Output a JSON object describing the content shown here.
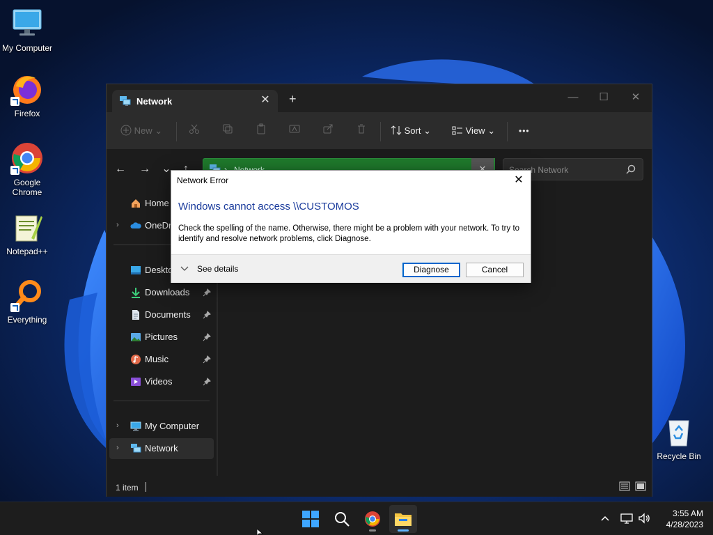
{
  "desktop": {
    "icons": [
      {
        "label": "My Computer",
        "icon": "monitor-icon"
      },
      {
        "label": "Firefox",
        "icon": "firefox-icon"
      },
      {
        "label": "Google Chrome",
        "icon": "chrome-icon"
      },
      {
        "label": "Notepad++",
        "icon": "notepad-plus-plus-icon"
      },
      {
        "label": "Everything",
        "icon": "everything-search-icon"
      },
      {
        "label": "Recycle Bin",
        "icon": "recycle-bin-icon"
      }
    ]
  },
  "explorer": {
    "tab_title": "Network",
    "tab_close": "✕",
    "new_tab": "+",
    "window_controls": {
      "minimize": "—",
      "maximize": "☐",
      "close": "✕"
    },
    "toolbar": {
      "new_label": "New",
      "sort_label": "Sort",
      "view_label": "View",
      "more_label": "•••"
    },
    "address": {
      "path": "Network",
      "clear": "✕"
    },
    "search": {
      "placeholder": "Search Network"
    },
    "sidebar": {
      "items": [
        {
          "label": "Home",
          "icon": "home-icon",
          "pinned": false,
          "expandable": false
        },
        {
          "label": "OneDrive",
          "icon": "cloud-icon",
          "pinned": false,
          "expandable": true
        },
        {
          "label": "Desktop",
          "icon": "desktop-folder-icon",
          "pinned": true,
          "expandable": false
        },
        {
          "label": "Downloads",
          "icon": "download-icon",
          "pinned": true,
          "expandable": false
        },
        {
          "label": "Documents",
          "icon": "documents-icon",
          "pinned": true,
          "expandable": false
        },
        {
          "label": "Pictures",
          "icon": "pictures-icon",
          "pinned": true,
          "expandable": false
        },
        {
          "label": "Music",
          "icon": "music-icon",
          "pinned": true,
          "expandable": false
        },
        {
          "label": "Videos",
          "icon": "videos-icon",
          "pinned": true,
          "expandable": false
        },
        {
          "label": "My Computer",
          "icon": "monitor-icon",
          "pinned": false,
          "expandable": true
        },
        {
          "label": "Network",
          "icon": "network-icon",
          "pinned": false,
          "expandable": true,
          "selected": true
        }
      ]
    },
    "status": {
      "item_count": "1 item"
    }
  },
  "dialog": {
    "title": "Network Error",
    "close": "✕",
    "heading": "Windows cannot access \\\\CUSTOMOS",
    "message": "Check the spelling of the name. Otherwise, there might be a problem with your network. To try to identify and resolve network problems, click Diagnose.",
    "details_label": "See details",
    "diagnose_label": "Diagnose",
    "cancel_label": "Cancel"
  },
  "taskbar": {
    "apps": [
      {
        "name": "start-button",
        "icon": "windows-logo-icon"
      },
      {
        "name": "search-button",
        "icon": "search-icon"
      },
      {
        "name": "chrome-taskbar",
        "icon": "chrome-icon"
      },
      {
        "name": "file-explorer-taskbar",
        "icon": "folder-icon",
        "active": true
      }
    ],
    "clock": {
      "time": "3:55 AM",
      "date": "4/28/2023"
    }
  },
  "colors": {
    "accent": "#0066cc",
    "dialog_heading": "#1a3b9c",
    "address_bar": "#1f7a2c",
    "explorer_bg": "#1c1c1c"
  }
}
